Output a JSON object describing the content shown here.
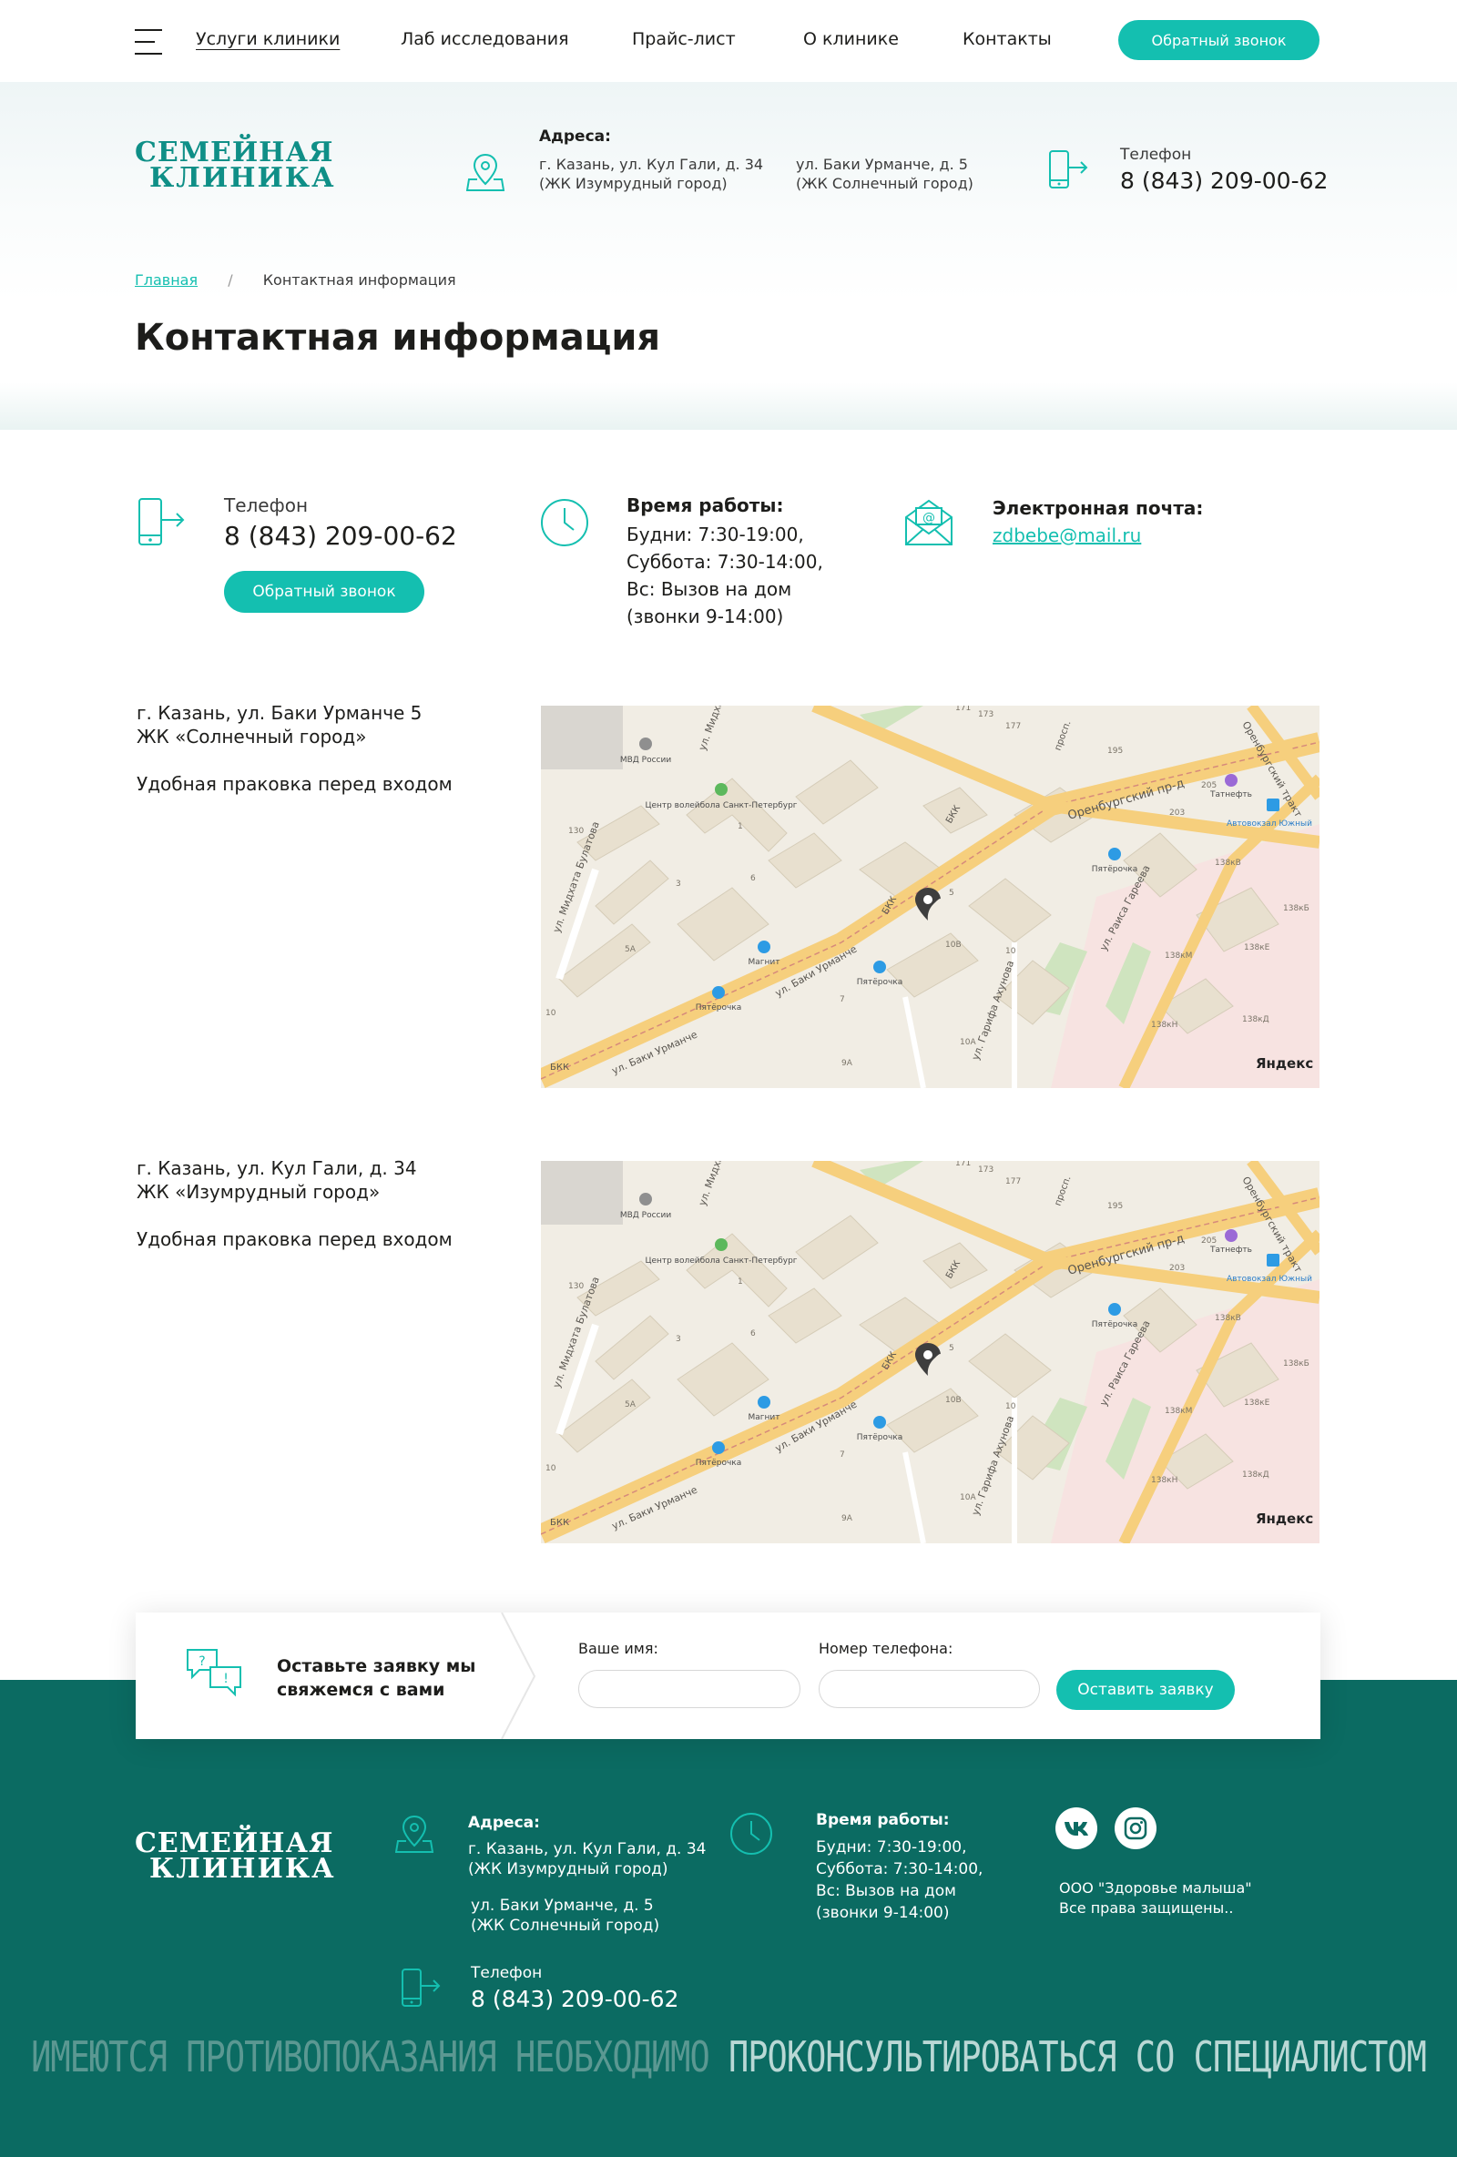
{
  "nav": {
    "items": [
      "Услуги клиники",
      "Лаб исследования",
      "Прайс-лист",
      "О клинике",
      "Контакты"
    ],
    "callback": "Обратный звонок"
  },
  "brand": {
    "line1": "СЕМЕЙНАЯ",
    "line2": "КЛИНИКА"
  },
  "header": {
    "addresses_label": "Адреса:",
    "address1_line1": "г. Казань, ул. Кул Гали, д. 34",
    "address1_line2": "(ЖК Изумрудный город)",
    "address2_line1": "ул. Баки Урманче, д. 5",
    "address2_line2": "(ЖК Солнечный город)",
    "phone_label": "Телефон",
    "phone": "8 (843) 209-00-62"
  },
  "breadcrumb": {
    "home": "Главная",
    "separator": "/",
    "current": "Контактная информация"
  },
  "page_title": "Контактная информация",
  "contacts": {
    "phone_label": "Телефон",
    "phone": "8 (843) 209-00-62",
    "callback": "Обратный звонок",
    "hours_label": "Время работы:",
    "hours": [
      "Будни: 7:30-19:00,",
      "Суббота: 7:30-14:00,",
      "Вс: Вызов на дом",
      "(звонки 9-14:00)"
    ],
    "email_label": "Электронная почта:",
    "email": "zdbebe@mail.ru"
  },
  "locations": [
    {
      "line1": "г. Казань, ул. Баки Урманче 5",
      "line2": "ЖК «Солнечный город»",
      "note": "Удобная праковка перед входом"
    },
    {
      "line1": "г. Казань, ул. Кул Гали, д. 34",
      "line2": "ЖК «Изумрудный город»",
      "note": "Удобная праковка перед входом"
    }
  ],
  "map": {
    "streets": [
      "ул. Баки Урманче",
      "ул. Баки Урманче",
      "Оренбургский пр-д",
      "ул. Раиса Гареева",
      "ул. Мидхата Булатова",
      "ул. Мидхата",
      "Оренбургский тракт",
      "ул. Гарифа Ахунова",
      "БКК",
      "БКК",
      "БКК",
      "просп."
    ],
    "pois": [
      "МВД России",
      "Центр волейбола Санкт-Петербург",
      "Магнит",
      "Пятёрочка",
      "Пятёрочка",
      "Пятёрочка",
      "Татнефть",
      "Автовокзал Южный"
    ],
    "numbers": [
      "130",
      "3",
      "6",
      "1",
      "5А",
      "10",
      "9А",
      "7",
      "10В",
      "10",
      "10А",
      "5",
      "195",
      "205",
      "203",
      "138кВ",
      "138кБ",
      "138кЕ",
      "138кМ",
      "138кД",
      "138кН",
      "177",
      "171",
      "173"
    ],
    "brand": "Яндекс"
  },
  "form": {
    "title_line1": "Оставьте заявку мы",
    "title_line2": "свяжемся с вами",
    "name_label": "Ваше имя:",
    "phone_label": "Номер телефона:",
    "submit": "Оставить заявку"
  },
  "footer": {
    "addresses_label": "Адреса:",
    "address1_line1": "г. Казань, ул. Кул Гали, д. 34",
    "address1_line2": "(ЖК Изумрудный город)",
    "address2_line1": "ул. Баки Урманче, д. 5",
    "address2_line2": "(ЖК Солнечный город)",
    "phone_label": "Телефон",
    "phone": "8 (843) 209-00-62",
    "hours_label": "Время работы:",
    "hours": [
      "Будни: 7:30-19:00,",
      "Суббота: 7:30-14:00,",
      "Вс: Вызов на дом",
      "(звонки 9-14:00)"
    ],
    "company": "ООО \"Здоровье малыша\"",
    "rights": "Все права защищены..",
    "warning_a": "ИМЕЮТСЯ ПРОТИВОПОКАЗАНИЯ НЕОБХОДИМО",
    "warning_b": "ПРОКОНСУЛЬТИРОВАТЬСЯ СО СПЕЦИАЛИСТОМ"
  },
  "colors": {
    "accent": "#14bfb0",
    "brand": "#0f8f87",
    "footer": "#0b6b62"
  }
}
